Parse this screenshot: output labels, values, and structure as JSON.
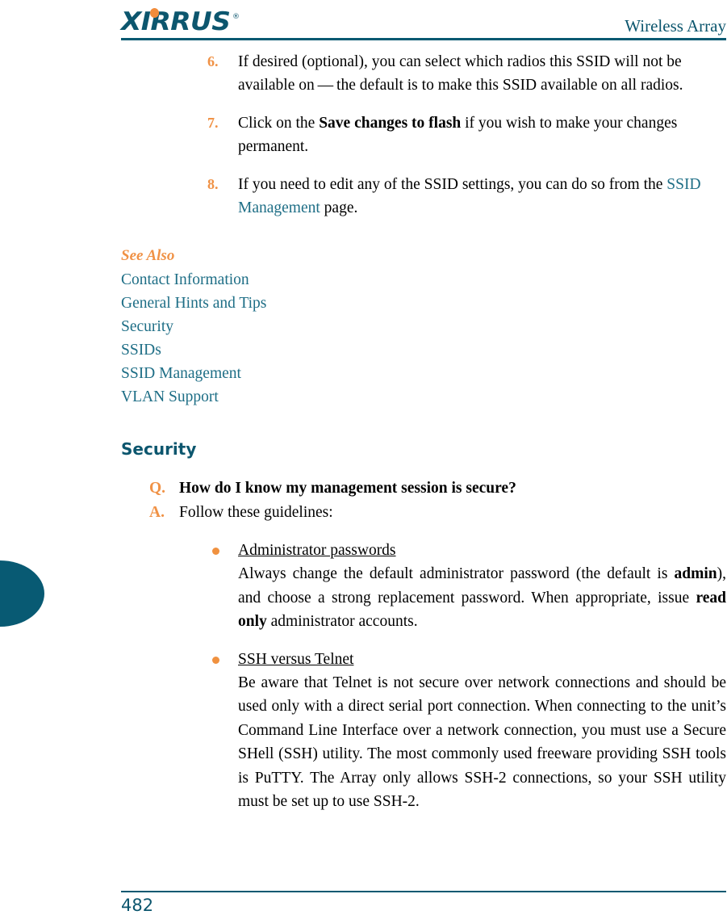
{
  "header": {
    "logo_text": "XIRRUS",
    "logo_trademark": "®",
    "title": "Wireless Array"
  },
  "steps": [
    {
      "marker": "6.",
      "parts": [
        {
          "text": "If desired (optional), you can select which radios this SSID will not be available on — the default is to make this SSID available on all radios.",
          "style": "plain"
        }
      ]
    },
    {
      "marker": "7.",
      "parts": [
        {
          "text": "Click on the ",
          "style": "plain"
        },
        {
          "text": "Save changes to flash",
          "style": "bold"
        },
        {
          "text": " if you wish to make your changes permanent.",
          "style": "plain"
        }
      ]
    },
    {
      "marker": "8.",
      "parts": [
        {
          "text": "If you need to edit any of the SSID settings, you can do so from the ",
          "style": "plain"
        },
        {
          "text": "SSID Management",
          "style": "link"
        },
        {
          "text": " page.",
          "style": "plain"
        }
      ]
    }
  ],
  "see_also": {
    "title": "See Also",
    "links": [
      "Contact Information",
      "General Hints and Tips",
      "Security",
      "SSIDs",
      "SSID Management",
      "VLAN Support"
    ]
  },
  "section": {
    "heading": "Security",
    "qa": [
      {
        "marker": "Q.",
        "text": "How do I know my management session is secure?"
      },
      {
        "marker": "A.",
        "text": "Follow these guidelines:"
      }
    ],
    "bullets": [
      {
        "title": "Administrator passwords",
        "body_parts": [
          {
            "text": "Always change the default administrator password (the default is ",
            "style": "plain"
          },
          {
            "text": "admin",
            "style": "bold"
          },
          {
            "text": "), and choose a strong replacement password. When appropriate, issue ",
            "style": "plain"
          },
          {
            "text": "read only",
            "style": "bold"
          },
          {
            "text": " administrator accounts.",
            "style": "plain"
          }
        ]
      },
      {
        "title": "SSH versus Telnet",
        "body_parts": [
          {
            "text": "Be aware that Telnet is not secure over network connections and should be used only with a direct serial port connection. When connecting to the unit’s Command Line Interface over a network connection, you must use a Secure SHell (SSH) utility. The most commonly used freeware providing SSH tools is PuTTY. The Array only allows SSH-2 connections, so your SSH utility must be set up to use SSH-2.",
            "style": "plain"
          }
        ]
      }
    ]
  },
  "footer": {
    "page_number": "482"
  },
  "colors": {
    "teal": "#0C566E",
    "rule_teal": "#075971",
    "orange": "#F09246",
    "link_teal": "#1E6E86",
    "tab_teal": "#085A73"
  }
}
